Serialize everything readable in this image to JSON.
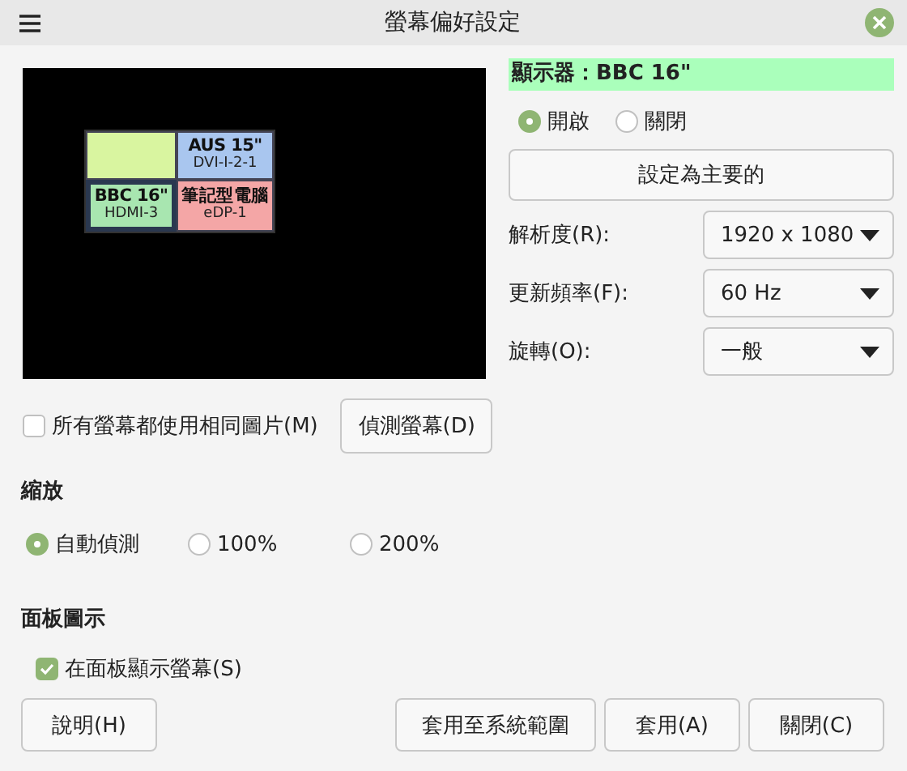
{
  "window": {
    "title": "螢幕偏好設定"
  },
  "layout": {
    "monitors": [
      {
        "color": "#d9f5a0",
        "selected": false
      },
      {
        "name": "AUS 15\"",
        "connector": "DVI-I-2-1",
        "color": "#a9c6ef",
        "selected": false
      },
      {
        "name": "BBC 16\"",
        "connector": "HDMI-3",
        "color": "#a8e6b0",
        "selected": true
      },
      {
        "name": "筆記型電腦",
        "connector": "eDP-1",
        "color": "#f4a6a6",
        "selected": false
      }
    ]
  },
  "display": {
    "heading": "顯示器：BBC 16\"",
    "power": [
      {
        "label": "開啟",
        "selected": true
      },
      {
        "label": "關閉",
        "selected": false
      }
    ],
    "primary_button": "設定為主要的",
    "settings": [
      {
        "label": "解析度(R):",
        "value": "1920 x 1080"
      },
      {
        "label": "更新頻率(F):",
        "value": "60 Hz"
      },
      {
        "label": "旋轉(O):",
        "value": "一般"
      }
    ]
  },
  "mirror": {
    "label": "所有螢幕都使用相同圖片(M)",
    "checked": false
  },
  "detect_button": "偵測螢幕(D)",
  "scaling": {
    "title": "縮放",
    "options": [
      {
        "label": "自動偵測",
        "selected": true
      },
      {
        "label": "100%",
        "selected": false
      },
      {
        "label": "200%",
        "selected": false
      }
    ]
  },
  "panel_icon": {
    "title": "面板圖示",
    "label": "在面板顯示螢幕(S)",
    "checked": true
  },
  "buttons": {
    "help": "說明(H)",
    "actions": [
      "套用至系統範圍",
      "套用(A)",
      "關閉(C)"
    ]
  }
}
